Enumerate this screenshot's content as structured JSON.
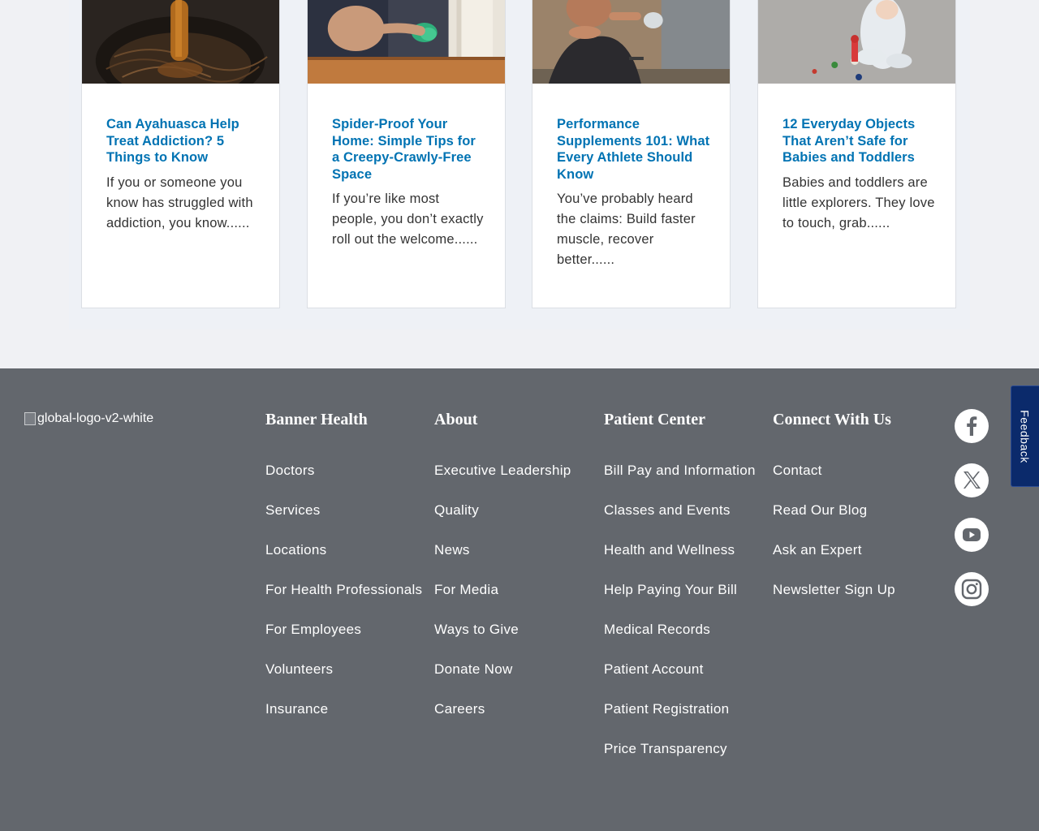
{
  "articles": [
    {
      "title": "Can Ayahuasca Help Treat Addiction? 5 Things to Know",
      "excerpt": "If you or someone you know has struggled with addiction, you know......"
    },
    {
      "title": "Spider-Proof Your Home: Simple Tips for a Creepy-Crawly-Free Space",
      "excerpt": "If you’re like most people, you don’t exactly roll out the welcome......"
    },
    {
      "title": "Performance Supplements 101: What Every Athlete Should Know",
      "excerpt": "You’ve probably heard the claims: Build faster muscle, recover better......"
    },
    {
      "title": "12 Everyday Objects That Aren’t Safe for Babies and Toddlers",
      "excerpt": "Babies and toddlers are little explorers. They love to touch, grab......"
    }
  ],
  "footer": {
    "logo_alt": "global-logo-v2-white",
    "columns": [
      {
        "heading": "Banner Health",
        "links": [
          "Doctors",
          "Services",
          "Locations",
          "For Health Professionals",
          "For Employees",
          "Volunteers",
          "Insurance"
        ]
      },
      {
        "heading": "About",
        "links": [
          "Executive Leadership",
          "Quality",
          "News",
          "For Media",
          "Ways to Give",
          "Donate Now",
          "Careers"
        ]
      },
      {
        "heading": "Patient Center",
        "links": [
          "Bill Pay and Information",
          "Classes and Events",
          "Health and Wellness",
          "Help Paying Your Bill",
          "Medical Records",
          "Patient Account",
          "Patient Registration",
          "Price Transparency"
        ]
      },
      {
        "heading": "Connect With Us",
        "links": [
          "Contact",
          "Read Our Blog",
          "Ask an Expert",
          "Newsletter Sign Up"
        ]
      }
    ],
    "social_icons": [
      "facebook-icon",
      "x-icon",
      "youtube-icon",
      "instagram-icon"
    ]
  },
  "feedback_tab": {
    "label": "Feedback"
  },
  "colors": {
    "link_blue": "#0073b3",
    "footer_bg": "#63676d",
    "feedback_bg": "#0b2a6b"
  }
}
